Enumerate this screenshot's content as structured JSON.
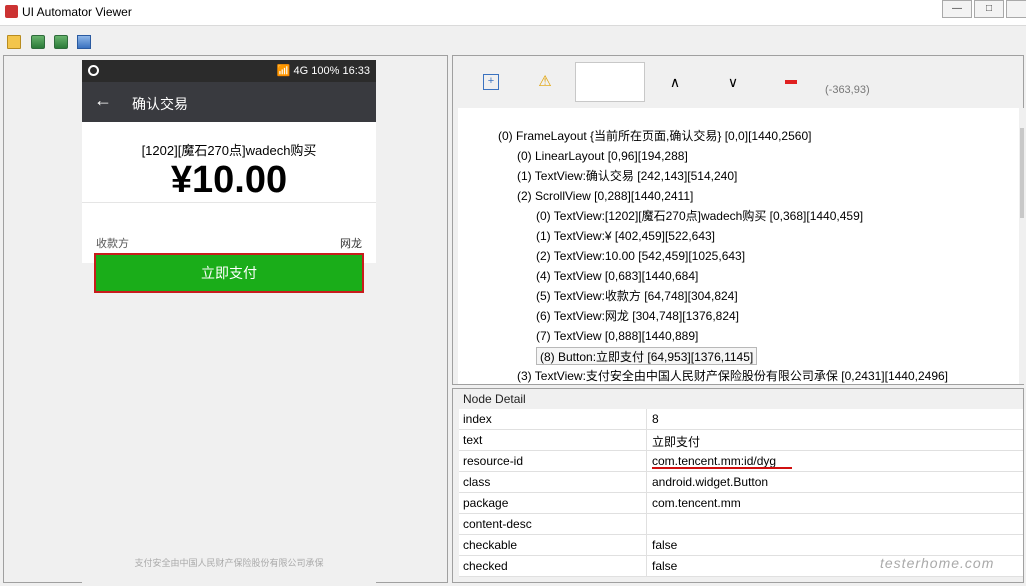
{
  "window": {
    "title": "UI Automator Viewer",
    "controls": [
      "minimize-icon",
      "maximize-icon",
      "close-icon"
    ]
  },
  "toolbar": {
    "buttons": [
      "open-icon",
      "device-screenshot-icon",
      "device-screenshot-compressed-icon",
      "save-icon"
    ]
  },
  "phone": {
    "status_time": "16:33",
    "status_network": "4G",
    "status_battery": "100%",
    "app_title": "确认交易",
    "pay_desc": "[1202][魔石270点]wadech购买",
    "amount": "¥10.00",
    "payee_label": "收款方",
    "payee_value": "网龙",
    "pay_button": "立即支付",
    "footer_note": "支付安全由中国人民财产保险股份有限公司承保"
  },
  "tree_tools": {
    "coords": "(-363,93)"
  },
  "tree": [
    {
      "indent": 0,
      "text": "(0) FrameLayout {当前所在页面,确认交易} [0,0][1440,2560]"
    },
    {
      "indent": 1,
      "text": "(0) LinearLayout [0,96][194,288]"
    },
    {
      "indent": 1,
      "text": "(1) TextView:确认交易 [242,143][514,240]"
    },
    {
      "indent": 1,
      "text": "(2) ScrollView [0,288][1440,2411]"
    },
    {
      "indent": 2,
      "text": "(0) TextView:[1202][魔石270点]wadech购买 [0,368][1440,459]"
    },
    {
      "indent": 2,
      "text": "(1) TextView:¥ [402,459][522,643]"
    },
    {
      "indent": 2,
      "text": "(2) TextView:10.00 [542,459][1025,643]"
    },
    {
      "indent": 2,
      "text": "(4) TextView [0,683][1440,684]"
    },
    {
      "indent": 2,
      "text": "(5) TextView:收款方 [64,748][304,824]"
    },
    {
      "indent": 2,
      "text": "(6) TextView:网龙 [304,748][1376,824]"
    },
    {
      "indent": 2,
      "text": "(7) TextView [0,888][1440,889]"
    },
    {
      "indent": 2,
      "text": "(8) Button:立即支付 [64,953][1376,1145]",
      "selected": true
    },
    {
      "indent": 1,
      "text": "(3) TextView:支付安全由中国人民财产保险股份有限公司承保 [0,2431][1440,2496]"
    }
  ],
  "node_detail": {
    "title": "Node Detail",
    "rows": [
      {
        "key": "index",
        "value": "8"
      },
      {
        "key": "text",
        "value": "立即支付"
      },
      {
        "key": "resource-id",
        "value": "com.tencent.mm:id/dyg"
      },
      {
        "key": "class",
        "value": "android.widget.Button"
      },
      {
        "key": "package",
        "value": "com.tencent.mm"
      },
      {
        "key": "content-desc",
        "value": ""
      },
      {
        "key": "checkable",
        "value": "false"
      },
      {
        "key": "checked",
        "value": "false"
      }
    ]
  },
  "watermark": "testerhome.com"
}
